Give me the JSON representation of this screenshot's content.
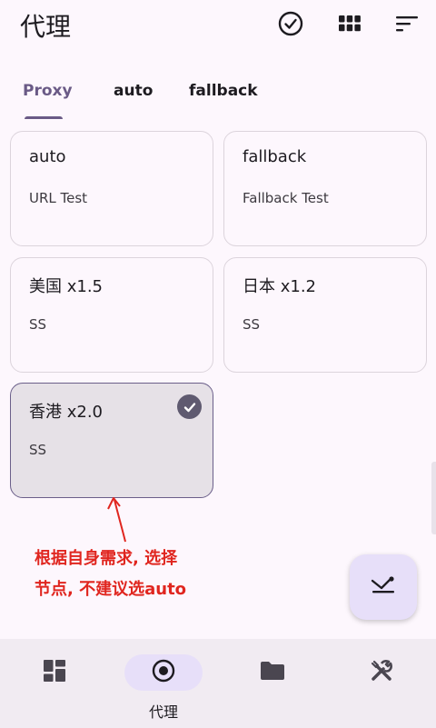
{
  "header": {
    "title": "代理",
    "icons": [
      "check-circle-icon",
      "grid-icon",
      "sort-icon"
    ]
  },
  "tabs": [
    {
      "label": "Proxy",
      "active": true
    },
    {
      "label": "auto",
      "active": false
    },
    {
      "label": "fallback",
      "active": false
    }
  ],
  "proxies": [
    {
      "name": "auto",
      "type": "URL Test",
      "selected": false
    },
    {
      "name": "fallback",
      "type": "Fallback Test",
      "selected": false
    },
    {
      "name": "美国 x1.5",
      "type": "SS",
      "selected": false
    },
    {
      "name": "日本 x1.2",
      "type": "SS",
      "selected": false
    },
    {
      "name": "香港 x2.0",
      "type": "SS",
      "selected": true
    }
  ],
  "annotation": {
    "line1": "根据自身需求, 选择",
    "line2": "节点, 不建议选auto",
    "color": "#e0261f"
  },
  "fab": {
    "icon": "speed-test-icon"
  },
  "nav": {
    "items": [
      {
        "icon": "dashboard-icon",
        "label": ""
      },
      {
        "icon": "proxy-icon",
        "label": "代理",
        "active": true
      },
      {
        "icon": "folder-icon",
        "label": ""
      },
      {
        "icon": "tools-icon",
        "label": ""
      }
    ]
  },
  "colors": {
    "accent": "#6a5a86",
    "selected_card": "#e6e1e7",
    "fab_bg": "#e7dff9",
    "nav_bg": "#f1ebf2"
  }
}
